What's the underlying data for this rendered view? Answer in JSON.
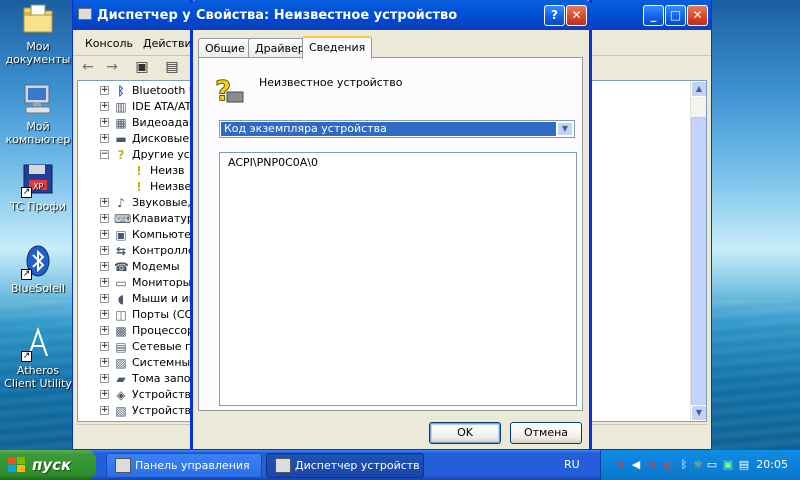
{
  "desktop": {
    "icons": [
      {
        "label": "Мои документы"
      },
      {
        "label": "Мой компьютер"
      },
      {
        "label": "TC Профи"
      },
      {
        "label": "BlueSoleil"
      },
      {
        "label": "Atheros Client Utility"
      }
    ]
  },
  "device_manager": {
    "title": "Диспетчер устройств",
    "menu": [
      "Консоль",
      "Действие"
    ],
    "tree": [
      {
        "label": "Bluetooth U",
        "expanded": false,
        "icon": "bluetooth-icon"
      },
      {
        "label": "IDE ATA/AT",
        "expanded": false,
        "icon": "ide-controller-icon"
      },
      {
        "label": "Видеоадап",
        "expanded": false,
        "icon": "display-adapter-icon"
      },
      {
        "label": "Дисковые",
        "expanded": false,
        "icon": "disk-drive-icon"
      },
      {
        "label": "Другие уст",
        "expanded": true,
        "icon": "unknown-device-icon"
      },
      {
        "label": "Неизв",
        "child": true,
        "icon": "warning-device-icon"
      },
      {
        "label": "Неизве",
        "child": true,
        "icon": "warning-device-icon"
      },
      {
        "label": "Звуковые,",
        "expanded": false,
        "icon": "sound-icon"
      },
      {
        "label": "Клавиатур",
        "expanded": false,
        "icon": "keyboard-icon"
      },
      {
        "label": "Компьютер",
        "expanded": false,
        "icon": "computer-icon"
      },
      {
        "label": "Контролле",
        "expanded": false,
        "icon": "usb-controller-icon"
      },
      {
        "label": "Модемы",
        "expanded": false,
        "icon": "modem-icon"
      },
      {
        "label": "Мониторы",
        "expanded": false,
        "icon": "monitor-icon"
      },
      {
        "label": "Мыши и ин",
        "expanded": false,
        "icon": "mouse-icon"
      },
      {
        "label": "Порты (СО",
        "expanded": false,
        "icon": "port-icon"
      },
      {
        "label": "Процессор",
        "expanded": false,
        "icon": "processor-icon"
      },
      {
        "label": "Сетевые п",
        "expanded": false,
        "icon": "network-adapter-icon"
      },
      {
        "label": "Системные",
        "expanded": false,
        "icon": "system-device-icon"
      },
      {
        "label": "Тома запом",
        "expanded": false,
        "icon": "storage-volume-icon"
      },
      {
        "label": "Устройства",
        "expanded": false,
        "icon": "hid-icon"
      },
      {
        "label": "Устройства",
        "expanded": false,
        "icon": "printer-icon"
      }
    ]
  },
  "dialog": {
    "title": "Свойства: Неизвестное устройство",
    "help_label": "?",
    "close_label": "✕",
    "tabs": [
      "Общие",
      "Драйвер",
      "Сведения"
    ],
    "active_tab": "Сведения",
    "device_name": "Неизвестное устройство",
    "property_select": "Код экземпляра устройства",
    "value": "ACPI\\PNP0C0A\\0",
    "ok_label": "OK",
    "cancel_label": "Отмена"
  },
  "taskbar": {
    "start_label": "пуск",
    "buttons": [
      {
        "label": "Панель управления",
        "active": false
      },
      {
        "label": "Диспетчер устройств",
        "active": true
      }
    ],
    "language": "RU",
    "clock": "20:05"
  }
}
